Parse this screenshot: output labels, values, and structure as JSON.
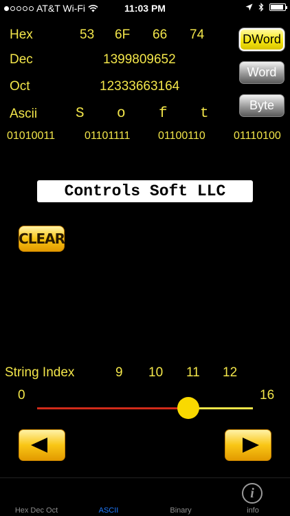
{
  "status_bar": {
    "carrier": "AT&T Wi-Fi",
    "time": "11:03 PM"
  },
  "converter": {
    "hex_label": "Hex",
    "hex_values": [
      "53",
      "6F",
      "66",
      "74"
    ],
    "dec_label": "Dec",
    "dec_value": "1399809652",
    "oct_label": "Oct",
    "oct_value": "12333663164",
    "ascii_label": "Ascii",
    "ascii_chars": [
      "S",
      "o",
      "f",
      "t"
    ],
    "binary_values": [
      "01010011",
      "01101111",
      "01100110",
      "01110100"
    ]
  },
  "word_size": {
    "options": [
      "DWord",
      "Word",
      "Byte"
    ],
    "selected": "DWord"
  },
  "banner_text": "Controls Soft LLC",
  "clear_label": "CLEAR",
  "string_index": {
    "label": "String Index",
    "indices": [
      "9",
      "10",
      "11",
      "12"
    ],
    "min_label": "0",
    "max_label": "16",
    "value_fraction": 0.7
  },
  "tabs": [
    {
      "label": "Hex Dec Oct"
    },
    {
      "label": "ASCII"
    },
    {
      "label": "Binary"
    },
    {
      "label": "info"
    }
  ],
  "active_tab": "ASCII",
  "colors": {
    "text": "#f3e64a",
    "active_tab": "#1f7aff",
    "slider_filled": "#d12b1a",
    "slider_empty": "#f3e64a"
  }
}
